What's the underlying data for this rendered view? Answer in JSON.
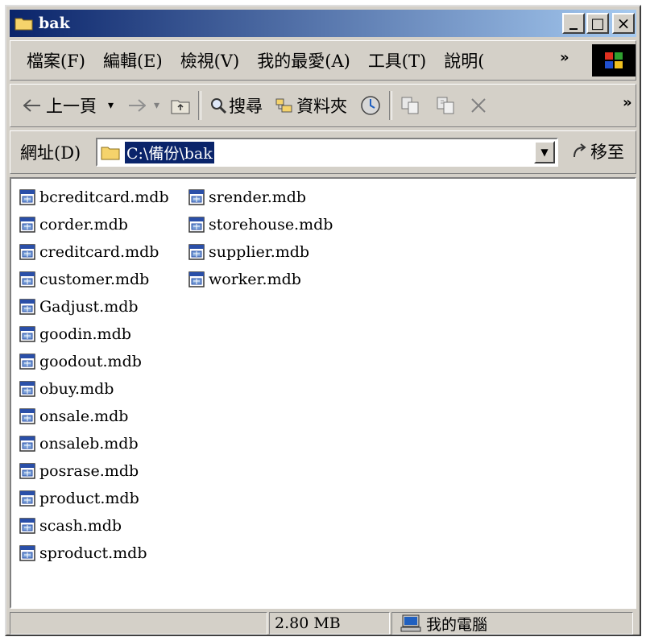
{
  "window": {
    "title": "bak"
  },
  "title_buttons": {
    "minimize": "_",
    "maximize": "□",
    "close": "×"
  },
  "menu": [
    "檔案(F)",
    "編輯(E)",
    "檢視(V)",
    "我的最愛(A)",
    "工具(T)",
    "說明("
  ],
  "menu_overflow": "»",
  "toolbar": {
    "back_label": "上一頁",
    "search_label": "搜尋",
    "folders_label": "資料夾",
    "overflow": "»"
  },
  "address": {
    "label": "網址(D)",
    "value": "C:\\備份\\bak",
    "go_label": "移至"
  },
  "files_col1": [
    "bcreditcard.mdb",
    "corder.mdb",
    "creditcard.mdb",
    "customer.mdb",
    "Gadjust.mdb",
    "goodin.mdb",
    "goodout.mdb",
    "obuy.mdb",
    "onsale.mdb",
    "onsaleb.mdb",
    "posrase.mdb",
    "product.mdb",
    "scash.mdb",
    "sproduct.mdb"
  ],
  "files_col2": [
    "srender.mdb",
    "storehouse.mdb",
    "supplier.mdb",
    "worker.mdb"
  ],
  "status": {
    "size": "2.80 MB",
    "zone": "我的電腦"
  }
}
